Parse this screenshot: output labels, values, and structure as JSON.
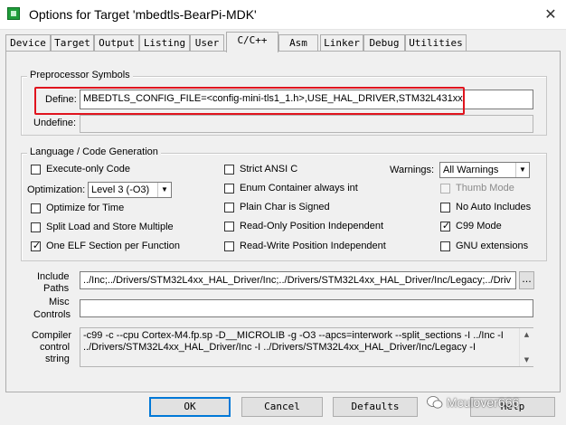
{
  "window": {
    "title": "Options for Target 'mbedtls-BearPi-MDK'",
    "close_glyph": "✕"
  },
  "tabs": [
    {
      "label": "Device"
    },
    {
      "label": "Target"
    },
    {
      "label": "Output"
    },
    {
      "label": "Listing"
    },
    {
      "label": "User"
    },
    {
      "label": "C/C++",
      "active": true
    },
    {
      "label": "Asm"
    },
    {
      "label": "Linker"
    },
    {
      "label": "Debug"
    },
    {
      "label": "Utilities"
    }
  ],
  "preprocessor": {
    "group_label": "Preprocessor Symbols",
    "define_label": "Define:",
    "define_value": "MBEDTLS_CONFIG_FILE=<config-mini-tls1_1.h>,USE_HAL_DRIVER,STM32L431xx",
    "undefine_label": "Undefine:",
    "undefine_value": "",
    "highlight_color": "#e0141e"
  },
  "language": {
    "group_label": "Language / Code Generation",
    "execute_only": {
      "label": "Execute-only Code",
      "checked": false
    },
    "optimization_label": "Optimization:",
    "optimization_value": "Level 3 (-O3)",
    "optimize_time": {
      "label": "Optimize for Time",
      "checked": false
    },
    "split_load": {
      "label": "Split Load and Store Multiple",
      "checked": false
    },
    "one_elf": {
      "label": "One ELF Section per Function",
      "checked": true
    },
    "strict_ansi": {
      "label": "Strict ANSI C",
      "checked": false
    },
    "enum_container": {
      "label": "Enum Container always int",
      "checked": false
    },
    "plain_char": {
      "label": "Plain Char is Signed",
      "checked": false
    },
    "ro_pos": {
      "label": "Read-Only Position Independent",
      "checked": false
    },
    "rw_pos": {
      "label": "Read-Write Position Independent",
      "checked": false
    },
    "warnings_label": "Warnings:",
    "warnings_value": "All Warnings",
    "thumb_mode": {
      "label": "Thumb Mode",
      "checked": false,
      "disabled": true
    },
    "no_auto_includes": {
      "label": "No Auto Includes",
      "checked": false
    },
    "c99_mode": {
      "label": "C99 Mode",
      "checked": true
    },
    "gnu_ext": {
      "label": "GNU extensions",
      "checked": false
    }
  },
  "include": {
    "label_line1": "Include",
    "label_line2": "Paths",
    "value": "../Inc;../Drivers/STM32L4xx_HAL_Driver/Inc;../Drivers/STM32L4xx_HAL_Driver/Inc/Legacy;../Driv",
    "browse_label": "..."
  },
  "misc": {
    "label_line1": "Misc",
    "label_line2": "Controls",
    "value": ""
  },
  "compiler": {
    "label_line1": "Compiler",
    "label_line2": "control",
    "label_line3": "string",
    "line1": "-c99 -c --cpu Cortex-M4.fp.sp -D__MICROLIB -g -O3 --apcs=interwork --split_sections -I ../Inc -I",
    "line2": "../Drivers/STM32L4xx_HAL_Driver/Inc -I ../Drivers/STM32L4xx_HAL_Driver/Inc/Legacy -I"
  },
  "buttons": {
    "ok": "OK",
    "cancel": "Cancel",
    "defaults": "Defaults",
    "help": "Help"
  },
  "watermark": {
    "text": "Mculover666"
  }
}
